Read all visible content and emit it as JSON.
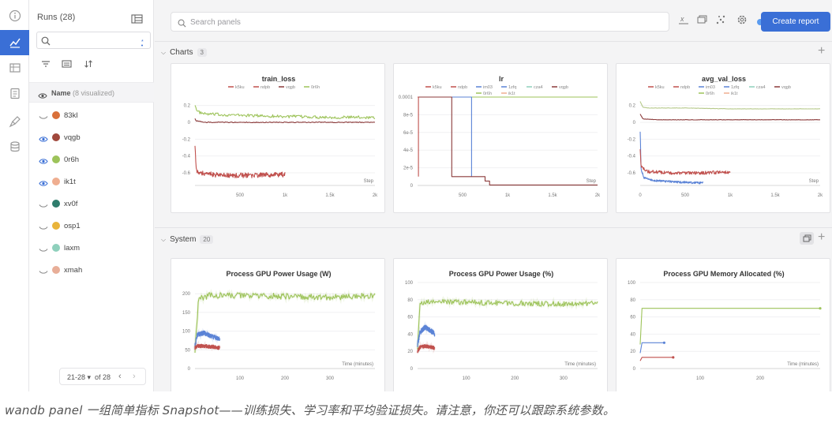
{
  "runs_panel": {
    "title": "Runs (28)",
    "name_header": "Name",
    "visualized": "(8 visualized)",
    "pagination": "21-28",
    "pagination_of": "of 28",
    "runs": [
      {
        "name": "83kl",
        "color": "#d9703a",
        "visible": false
      },
      {
        "name": "vqgb",
        "color": "#a0483c",
        "visible": true
      },
      {
        "name": "0r6h",
        "color": "#9dc35a",
        "visible": true
      },
      {
        "name": "ik1t",
        "color": "#efae90",
        "visible": true
      },
      {
        "name": "xv0f",
        "color": "#2f7d6d",
        "visible": false
      },
      {
        "name": "osp1",
        "color": "#e9b43a",
        "visible": false
      },
      {
        "name": "laxm",
        "color": "#8fd0bc",
        "visible": false
      },
      {
        "name": "xmah",
        "color": "#e8ae98",
        "visible": false
      }
    ]
  },
  "toolbar": {
    "search_placeholder": "Search panels",
    "create_report": "Create report"
  },
  "sections": {
    "charts": {
      "title": "Charts",
      "count": "3"
    },
    "system": {
      "title": "System",
      "count": "20"
    }
  },
  "caption": "wandb panel 一组简单指标 Snapshot——训练损失、学习率和平均验证损失。请注意，你还可以跟踪系统参数。",
  "chart_data": [
    {
      "type": "line",
      "title": "train_loss",
      "xlabel": "Step",
      "xlim": [
        0,
        2000
      ],
      "ylim": [
        -0.75,
        0.3
      ],
      "xticks": [
        {
          "v": 500,
          "t": "500"
        },
        {
          "v": 1000,
          "t": "1k"
        },
        {
          "v": 1500,
          "t": "1.5k"
        },
        {
          "v": 2000,
          "t": "2k"
        }
      ],
      "yticks": [
        {
          "v": 0.2,
          "t": "0.2"
        },
        {
          "v": 0,
          "t": "0"
        },
        {
          "v": -0.2,
          "t": "-0.2"
        },
        {
          "v": -0.4,
          "t": "-0.4"
        },
        {
          "v": -0.6,
          "t": "-0.6"
        }
      ],
      "legend": [
        {
          "name": "k5ku",
          "color": "#c0504d"
        },
        {
          "name": "ndpb",
          "color": "#c0504d"
        },
        {
          "name": "vqgb",
          "color": "#8b3a3a"
        },
        {
          "name": "0r6h",
          "color": "#9dc35a"
        }
      ],
      "series": [
        {
          "name": "0r6h",
          "color": "#9dc35a",
          "noise": 0.018,
          "x": [
            0,
            20,
            100,
            300,
            1000,
            1500,
            2000
          ],
          "y": [
            0.22,
            0.13,
            0.1,
            0.09,
            0.07,
            0.06,
            0.06
          ]
        },
        {
          "name": "vqgb",
          "color": "#8b3a3a",
          "noise": 0.005,
          "x": [
            0,
            10,
            100,
            500,
            1000,
            1500,
            2000
          ],
          "y": [
            0.05,
            0.02,
            0.0,
            0.0,
            0.0,
            0.0,
            0.0
          ]
        },
        {
          "name": "k5ku",
          "color": "#c0504d",
          "noise": 0.03,
          "x": [
            0,
            8,
            20,
            100,
            300,
            600,
            1000
          ],
          "y": [
            -0.25,
            -0.45,
            -0.6,
            -0.61,
            -0.63,
            -0.63,
            -0.62
          ]
        }
      ]
    },
    {
      "type": "line",
      "title": "lr",
      "xlabel": "Step",
      "xlim": [
        0,
        2000
      ],
      "ylim": [
        0,
        0.0001
      ],
      "xticks": [
        {
          "v": 500,
          "t": "500"
        },
        {
          "v": 1000,
          "t": "1k"
        },
        {
          "v": 1500,
          "t": "1.5k"
        },
        {
          "v": 2000,
          "t": "2k"
        }
      ],
      "yticks": [
        {
          "v": 0.0001,
          "t": "0.0001"
        },
        {
          "v": 8e-05,
          "t": "8e-5"
        },
        {
          "v": 6e-05,
          "t": "6e-5"
        },
        {
          "v": 4e-05,
          "t": "4e-5"
        },
        {
          "v": 2e-05,
          "t": "2e-5"
        },
        {
          "v": 0,
          "t": "0"
        }
      ],
      "legend": [
        {
          "name": "k5ku",
          "color": "#c0504d"
        },
        {
          "name": "ndpb",
          "color": "#c0504d"
        },
        {
          "name": "im03",
          "color": "#5b83d6"
        },
        {
          "name": "1zfq",
          "color": "#5b83d6"
        },
        {
          "name": "cza4",
          "color": "#8fd0bc"
        },
        {
          "name": "vqgb",
          "color": "#8b3a3a"
        },
        {
          "name": "0r6h",
          "color": "#9dc35a"
        },
        {
          "name": "ik1t",
          "color": "#efae90"
        }
      ],
      "series": [
        {
          "name": "0r6h",
          "color": "#9dc35a",
          "noise": 0,
          "x": [
            0,
            2000
          ],
          "y": [
            0.0001,
            0.0001
          ]
        },
        {
          "name": "im03",
          "color": "#5b83d6",
          "noise": 0,
          "x": [
            0,
            600,
            600
          ],
          "y": [
            0.0001,
            0.0001,
            1e-05
          ]
        },
        {
          "name": "vqgb",
          "color": "#8b3a3a",
          "noise": 0,
          "x": [
            0,
            380,
            380,
            750,
            750,
            800,
            800,
            2000
          ],
          "y": [
            0.0001,
            0.0001,
            1e-05,
            1e-05,
            5e-06,
            5e-06,
            5e-07,
            5e-07
          ]
        },
        {
          "name": "k5ku",
          "color": "#c0504d",
          "noise": 0,
          "x": [
            0,
            10,
            10
          ],
          "y": [
            0.0001,
            0.0001,
            1e-05
          ]
        }
      ]
    },
    {
      "type": "line",
      "title": "avg_val_loss",
      "xlabel": "Step",
      "xlim": [
        0,
        2000
      ],
      "ylim": [
        -0.75,
        0.3
      ],
      "xticks": [
        {
          "v": 0,
          "t": "0"
        },
        {
          "v": 500,
          "t": "500"
        },
        {
          "v": 1000,
          "t": "1k"
        },
        {
          "v": 1500,
          "t": "1.5k"
        },
        {
          "v": 2000,
          "t": "2k"
        }
      ],
      "yticks": [
        {
          "v": 0.2,
          "t": "0.2"
        },
        {
          "v": 0,
          "t": "0"
        },
        {
          "v": -0.2,
          "t": "-0.2"
        },
        {
          "v": -0.4,
          "t": "-0.4"
        },
        {
          "v": -0.6,
          "t": "-0.6"
        }
      ],
      "legend": [
        {
          "name": "k5ku",
          "color": "#c0504d"
        },
        {
          "name": "ndpb",
          "color": "#c0504d"
        },
        {
          "name": "im03",
          "color": "#5b83d6"
        },
        {
          "name": "1zfq",
          "color": "#5b83d6"
        },
        {
          "name": "cza4",
          "color": "#8fd0bc"
        },
        {
          "name": "vqgb",
          "color": "#8b3a3a"
        },
        {
          "name": "0r6h",
          "color": "#9dc35a"
        },
        {
          "name": "ik1t",
          "color": "#efae90"
        }
      ],
      "series": [
        {
          "name": "0r6h",
          "color": "#b6c98a",
          "noise": 0.002,
          "x": [
            0,
            30,
            100,
            500,
            1000,
            1500,
            2000
          ],
          "y": [
            0.25,
            0.18,
            0.17,
            0.17,
            0.16,
            0.16,
            0.16
          ]
        },
        {
          "name": "vqgb",
          "color": "#8b3a3a",
          "noise": 0.002,
          "x": [
            0,
            30,
            200,
            1000,
            2000
          ],
          "y": [
            0.1,
            0.04,
            0.03,
            0.03,
            0.03
          ]
        },
        {
          "name": "im03",
          "color": "#5b83d6",
          "noise": 0.012,
          "x": [
            0,
            10,
            40,
            150,
            400,
            700
          ],
          "y": [
            -0.1,
            -0.55,
            -0.66,
            -0.69,
            -0.71,
            -0.72
          ]
        },
        {
          "name": "k5ku",
          "color": "#c0504d",
          "noise": 0.02,
          "x": [
            0,
            10,
            60,
            300,
            700,
            1000
          ],
          "y": [
            -0.3,
            -0.52,
            -0.58,
            -0.6,
            -0.6,
            -0.59
          ]
        }
      ]
    },
    {
      "type": "line",
      "title": "Process GPU Power Usage (W)",
      "xlabel": "Time (minutes)",
      "xlim": [
        0,
        400
      ],
      "ylim": [
        0,
        230
      ],
      "xticks": [
        {
          "v": 100,
          "t": "100"
        },
        {
          "v": 200,
          "t": "200"
        },
        {
          "v": 300,
          "t": "300"
        }
      ],
      "yticks": [
        {
          "v": 200,
          "t": "200"
        },
        {
          "v": 150,
          "t": "150"
        },
        {
          "v": 100,
          "t": "100"
        },
        {
          "v": 50,
          "t": "50"
        },
        {
          "v": 0,
          "t": "0"
        }
      ],
      "legend": [],
      "series": [
        {
          "name": "0r6h",
          "color": "#9dc35a",
          "noise": 8,
          "x": [
            0,
            8,
            30,
            100,
            200,
            300,
            400
          ],
          "y": [
            50,
            185,
            195,
            195,
            193,
            190,
            195
          ]
        },
        {
          "name": "im03",
          "color": "#5b83d6",
          "noise": 6,
          "x": [
            0,
            5,
            20,
            40,
            55
          ],
          "y": [
            60,
            90,
            95,
            85,
            80
          ]
        },
        {
          "name": "k5ku",
          "color": "#c0504d",
          "noise": 5,
          "x": [
            0,
            5,
            20,
            40,
            55
          ],
          "y": [
            55,
            60,
            60,
            58,
            55
          ]
        }
      ]
    },
    {
      "type": "line",
      "title": "Process GPU Power Usage (%)",
      "xlabel": "Time (minutes)",
      "xlim": [
        0,
        370
      ],
      "ylim": [
        0,
        100
      ],
      "xticks": [
        {
          "v": 100,
          "t": "100"
        },
        {
          "v": 200,
          "t": "200"
        },
        {
          "v": 300,
          "t": "300"
        }
      ],
      "yticks": [
        {
          "v": 100,
          "t": "100"
        },
        {
          "v": 80,
          "t": "80"
        },
        {
          "v": 60,
          "t": "60"
        },
        {
          "v": 40,
          "t": "40"
        },
        {
          "v": 20,
          "t": "20"
        },
        {
          "v": 0,
          "t": "0"
        }
      ],
      "legend": [],
      "series": [
        {
          "name": "0r6h",
          "color": "#9dc35a",
          "noise": 3,
          "x": [
            0,
            5,
            30,
            100,
            200,
            300,
            370
          ],
          "y": [
            25,
            75,
            78,
            77,
            76,
            75,
            76
          ]
        },
        {
          "name": "im03",
          "color": "#5b83d6",
          "noise": 3,
          "x": [
            0,
            5,
            15,
            25,
            35
          ],
          "y": [
            28,
            42,
            48,
            45,
            40
          ]
        },
        {
          "name": "k5ku",
          "color": "#c0504d",
          "noise": 2,
          "x": [
            0,
            5,
            15,
            25,
            35
          ],
          "y": [
            20,
            25,
            26,
            25,
            24
          ]
        }
      ]
    },
    {
      "type": "line",
      "title": "Process GPU Memory Allocated (%)",
      "xlabel": "Time (minutes)",
      "xlim": [
        0,
        300
      ],
      "ylim": [
        0,
        100
      ],
      "xticks": [
        {
          "v": 100,
          "t": "100"
        },
        {
          "v": 200,
          "t": "200"
        }
      ],
      "yticks": [
        {
          "v": 100,
          "t": "100"
        },
        {
          "v": 80,
          "t": "80"
        },
        {
          "v": 60,
          "t": "60"
        },
        {
          "v": 40,
          "t": "40"
        },
        {
          "v": 20,
          "t": "20"
        },
        {
          "v": 0,
          "t": "0"
        }
      ],
      "legend": [],
      "series": [
        {
          "name": "0r6h",
          "color": "#9dc35a",
          "noise": 0,
          "x": [
            0,
            3,
            300
          ],
          "y": [
            28,
            70,
            70
          ]
        },
        {
          "name": "im03",
          "color": "#5b83d6",
          "noise": 0,
          "x": [
            0,
            3,
            40
          ],
          "y": [
            18,
            30,
            30
          ]
        },
        {
          "name": "k5ku",
          "color": "#c0504d",
          "noise": 0,
          "x": [
            0,
            3,
            55
          ],
          "y": [
            9,
            13,
            13
          ]
        }
      ]
    }
  ]
}
